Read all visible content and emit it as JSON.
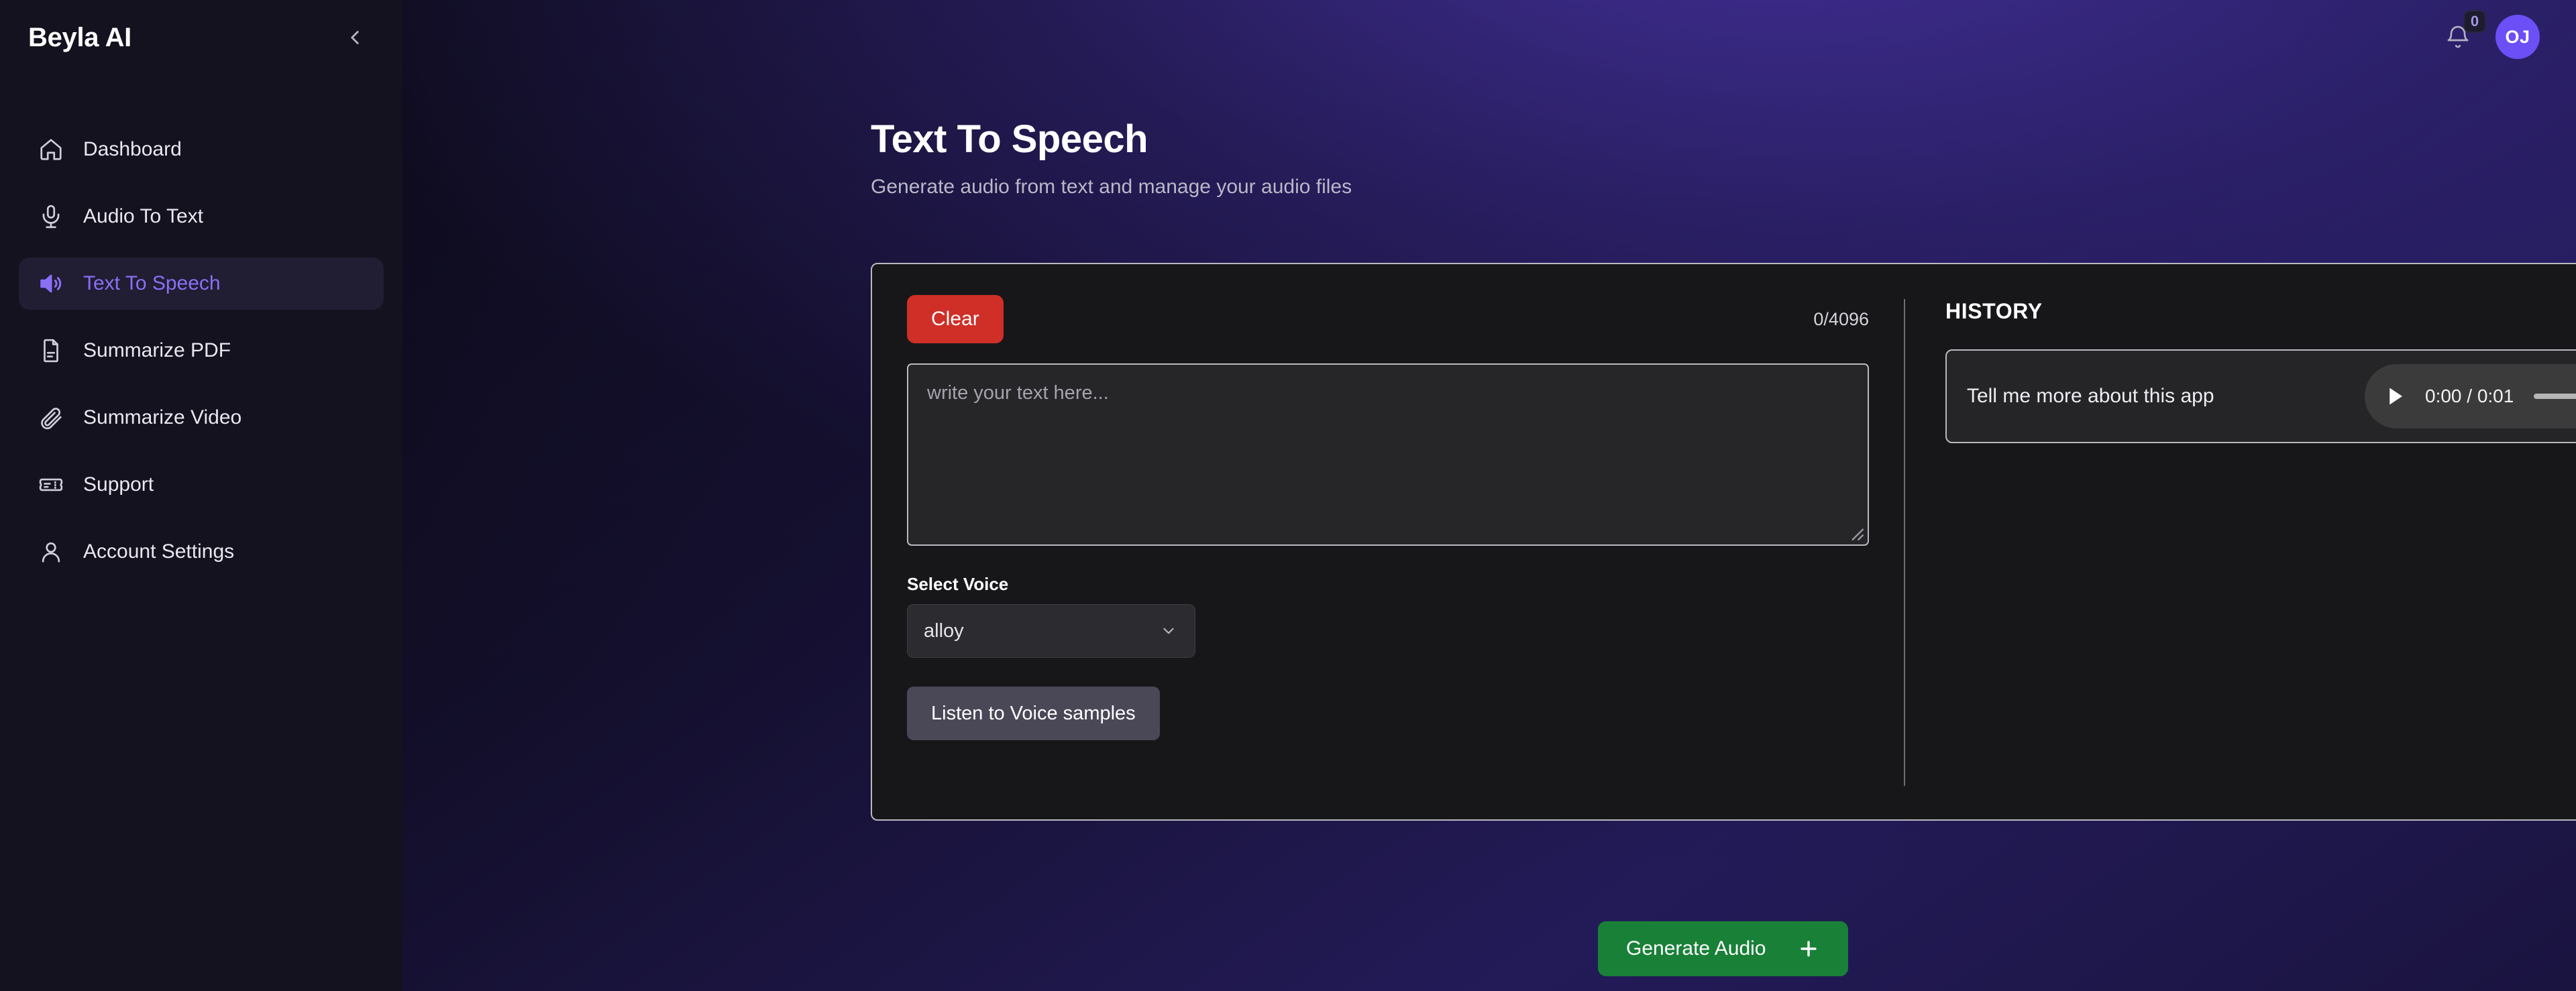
{
  "sidebar": {
    "brand": "Beyla AI",
    "collapse_icon": "chevron-left-icon",
    "items": [
      {
        "label": "Dashboard",
        "icon": "home-icon",
        "active": false
      },
      {
        "label": "Audio To Text",
        "icon": "microphone-icon",
        "active": false
      },
      {
        "label": "Text To Speech",
        "icon": "volume-up-icon",
        "active": true
      },
      {
        "label": "Summarize PDF",
        "icon": "file-text-icon",
        "active": false
      },
      {
        "label": "Summarize Video",
        "icon": "paperclip-icon",
        "active": false
      },
      {
        "label": "Support",
        "icon": "ticket-icon",
        "active": false
      },
      {
        "label": "Account Settings",
        "icon": "user-icon",
        "active": false
      }
    ]
  },
  "topbar": {
    "notifications_icon": "bell-icon",
    "notifications_count": "0",
    "avatar_initials": "OJ"
  },
  "page": {
    "title": "Text To Speech",
    "subtitle": "Generate audio from text and manage your audio files"
  },
  "editor": {
    "clear_label": "Clear",
    "char_count": "0/4096",
    "textarea_placeholder": "write your text here...",
    "textarea_value": "",
    "voice_label": "Select Voice",
    "voice_selected": "alloy",
    "voice_chevron_icon": "chevron-down-icon",
    "samples_label": "Listen to Voice samples",
    "generate_label": "Generate Audio",
    "generate_icon": "plus-icon"
  },
  "history": {
    "title": "HISTORY",
    "items": [
      {
        "text": "Tell me more about this app",
        "player": {
          "play_icon": "play-icon",
          "time": "0:00 / 0:01",
          "volume_icon": "volume-icon",
          "more_icon": "more-vertical-icon"
        },
        "download_icon": "download-arrow-icon",
        "delete_icon": "close-x-icon"
      }
    ]
  },
  "colors": {
    "accent": "#8b6ff5",
    "avatar": "#6c4ff6",
    "danger": "#cf2f27",
    "success": "#198038",
    "card_bg": "#17171a",
    "card_border": "#b9b9c0"
  }
}
